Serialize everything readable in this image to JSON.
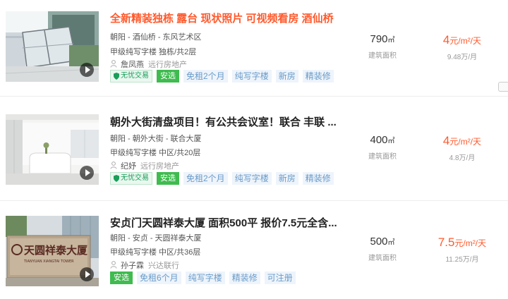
{
  "listings": [
    {
      "title": "全新精装独栋 露台 现状照片 可视频看房 酒仙桥",
      "location": "朝阳 - 酒仙桥 - 东风艺术区",
      "spec": "甲级纯写字楼   独栋/共2层",
      "agent": "詹凤燕",
      "company": "远行房地产",
      "tags": [
        "无忧交易",
        "安选",
        "免租2个月",
        "纯写字楼",
        "新房",
        "精装修"
      ],
      "area_value": "790",
      "area_unit": "㎡",
      "area_label": "建筑面积",
      "price_value": "4",
      "price_unit": "元/m²/天",
      "monthly": "9.48万/月"
    },
    {
      "title": "朝外大街清盘项目！有公共会议室！联合 丰联 ...",
      "location": "朝阳 - 朝外大街 - 联合大厦",
      "spec": "甲级纯写字楼   中区/共20层",
      "agent": "纪妤",
      "company": "远行房地产",
      "tags": [
        "无忧交易",
        "安选",
        "免租2个月",
        "纯写字楼",
        "新房",
        "精装修"
      ],
      "area_value": "400",
      "area_unit": "㎡",
      "area_label": "建筑面积",
      "price_value": "4",
      "price_unit": "元/m²/天",
      "monthly": "4.8万/月"
    },
    {
      "title": "安贞门天圆祥泰大厦 面积500平 报价7.5元全含...",
      "location": "朝阳 - 安贞 - 天圆祥泰大厦",
      "spec": "甲级纯写字楼   中区/共36层",
      "agent": "孙子霖",
      "company": "兴达联行",
      "tags": [
        "安选",
        "免租6个月",
        "纯写字楼",
        "精装修",
        "可注册"
      ],
      "area_value": "500",
      "area_unit": "㎡",
      "area_label": "建筑面积",
      "price_value": "7.5",
      "price_unit": "元/m²/天",
      "monthly": "11.25万/月"
    }
  ],
  "thumb_sign_text": "天圆祥泰大厦",
  "thumb_sign_sub": "TIANYUAN XIANGTAI TOWER",
  "colors": {
    "accent": "#ff5a2d",
    "tag_text": "#6a9bc9",
    "tag_bg": "#eef4fb",
    "anxuan": "#3fbb4f",
    "wuyou": "#1a9e5a"
  },
  "icons": [
    "play-icon",
    "person-icon",
    "shield-icon"
  ]
}
